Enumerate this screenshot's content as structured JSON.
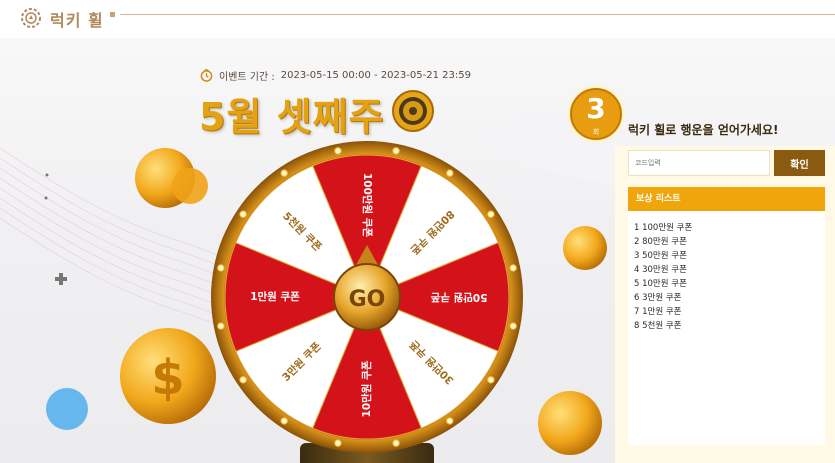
{
  "header": {
    "logo_text": "럭키 휠",
    "logo_icon": "lucky-wheel-logo-icon"
  },
  "event": {
    "period_label": "이벤트 기간 :",
    "period_value": "2023-05-15 00:00 - 2023-05-21 23:59",
    "title": "5월 셋째주"
  },
  "wheel": {
    "center_label": "GO",
    "segments": [
      "100만원 쿠폰",
      "80만원 쿠폰",
      "50만원 쿠폰",
      "30만원 쿠폰",
      "10만원 쿠폰",
      "3만원 쿠폰",
      "1만원 쿠폰",
      "5천원 쿠폰"
    ],
    "colors": {
      "red": "#d4121a",
      "white": "#ffffff",
      "gold": "#e2a93a",
      "text_on_red": "#ffffff",
      "text_on_white": "#a06a1b"
    }
  },
  "panel": {
    "count": "3",
    "count_unit": "회",
    "message": "럭키 휠로 행운을 얻어가세요!",
    "code_placeholder": "코드입력",
    "confirm_label": "확인",
    "rewards_title": "보상 리스트",
    "rewards": [
      "1 100만원 쿠폰",
      "2 80만원 쿠폰",
      "3 50만원 쿠폰",
      "4 30만원 쿠폰",
      "5 10만원 쿠폰",
      "6 3만원 쿠폰",
      "7 1만원 쿠폰",
      "8 5천원 쿠폰"
    ]
  },
  "colors": {
    "accent": "#f1a50d",
    "title": "#e3a214",
    "button": "#8a5a10",
    "panel_bg": "#fff9e6"
  }
}
